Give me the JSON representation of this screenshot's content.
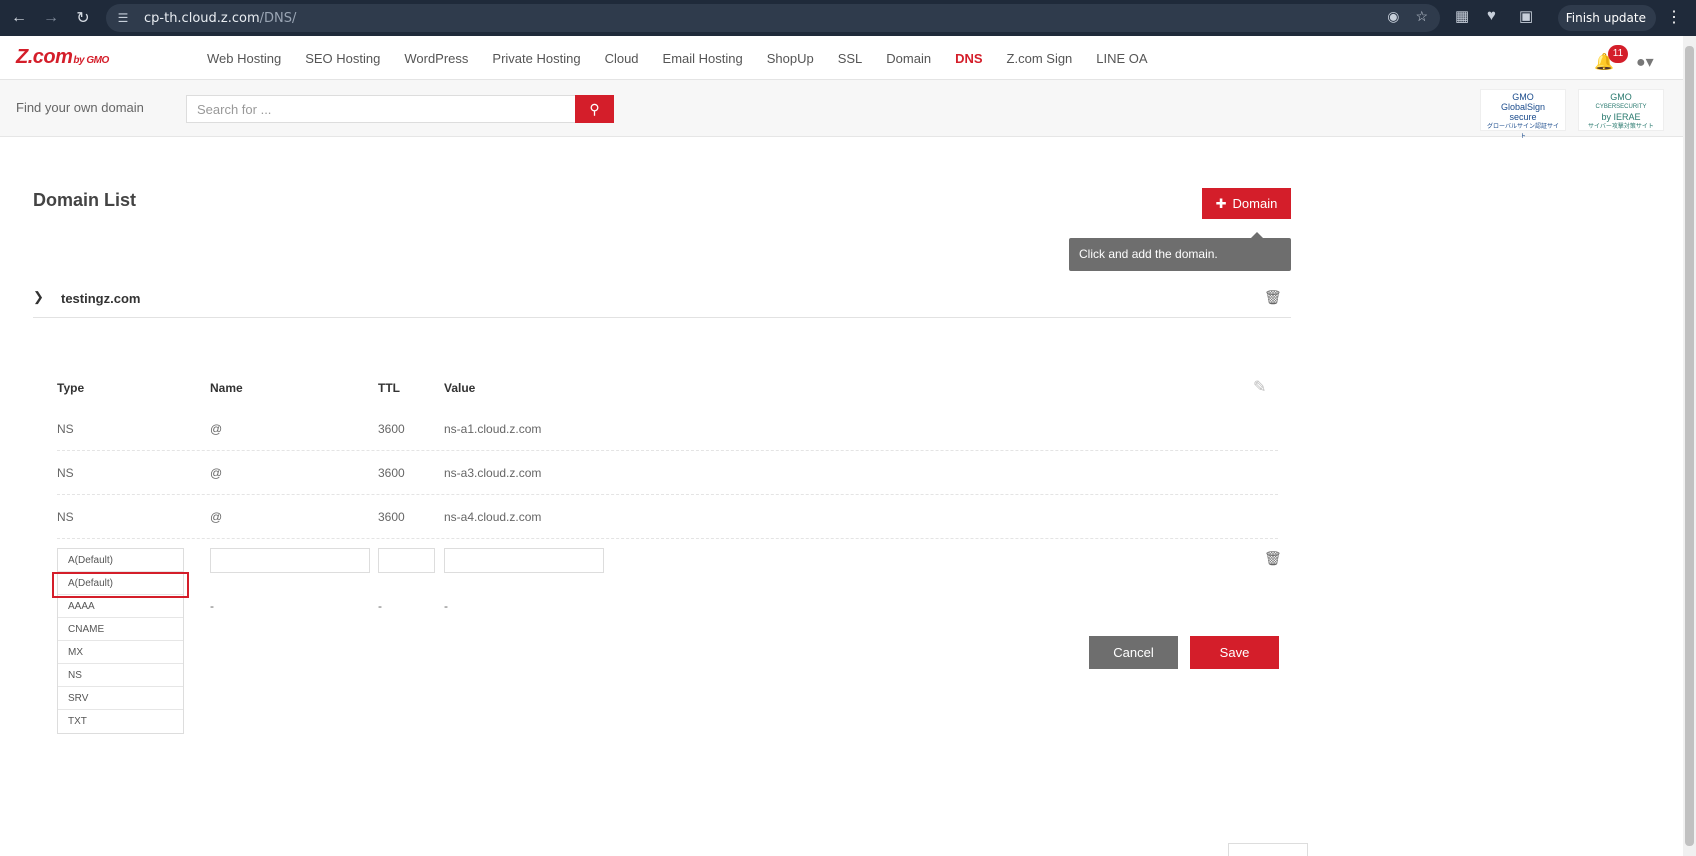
{
  "browser": {
    "url_host": "cp-th.cloud.z.com",
    "url_path": "/DNS/",
    "finish_update": "Finish update"
  },
  "header": {
    "logo": "Z.com",
    "logo_sub": "by GMO",
    "nav": [
      "Web Hosting",
      "SEO Hosting",
      "WordPress",
      "Private Hosting",
      "Cloud",
      "Email Hosting",
      "ShopUp",
      "SSL",
      "Domain",
      "DNS",
      "Z.com Sign",
      "LINE OA"
    ],
    "active_nav": "DNS",
    "notification_count": "11"
  },
  "search": {
    "label": "Find your own domain",
    "placeholder": "Search for ..."
  },
  "badges": {
    "globalsign": [
      "GMO",
      "GlobalSign",
      "secure",
      "グローバルサイン認証サイト"
    ],
    "ierae": [
      "GMO",
      "CYBERSECURITY",
      "by IERAE",
      "サイバー攻撃対策サイト"
    ]
  },
  "main": {
    "title": "Domain List",
    "add_domain": "Domain",
    "tooltip": "Click and add the domain.",
    "domain_name": "testingz.com",
    "columns": [
      "Type",
      "Name",
      "TTL",
      "Value"
    ],
    "records": [
      {
        "type": "NS",
        "name": "@",
        "ttl": "3600",
        "value": "ns-a1.cloud.z.com"
      },
      {
        "type": "NS",
        "name": "@",
        "ttl": "3600",
        "value": "ns-a3.cloud.z.com"
      },
      {
        "type": "NS",
        "name": "@",
        "ttl": "3600",
        "value": "ns-a4.cloud.z.com"
      }
    ],
    "type_options": [
      "A(Default)",
      "A(Default)",
      "AAAA",
      "CNAME",
      "MX",
      "NS",
      "SRV",
      "TXT"
    ],
    "dash": "-",
    "cancel": "Cancel",
    "save": "Save"
  }
}
